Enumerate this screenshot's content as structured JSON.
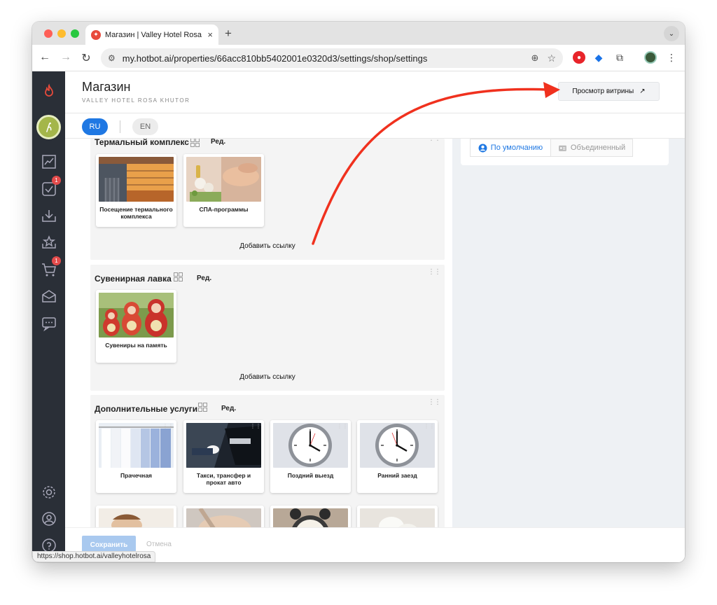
{
  "browser": {
    "tab_title": "Магазин | Valley Hotel Rosa Khutor",
    "tab_close": "×",
    "new_tab": "+",
    "url": "my.hotbot.ai/properties/66acc810bb5402001e0320d3/settings/shop/settings",
    "status_url": "https://shop.hotbot.ai/valleyhotelrosa"
  },
  "sidebar": {
    "badges": {
      "tasks": "1",
      "cart": "1"
    }
  },
  "header": {
    "title": "Магазин",
    "subtitle": "VALLEY HOTEL ROSA KHUTOR",
    "preview_label": "Просмотр витрины",
    "preview_icon": "↗"
  },
  "languages": {
    "ru": "RU",
    "en": "EN"
  },
  "view_toggle": {
    "default": "По умолчанию",
    "merged": "Объединенный"
  },
  "sections": [
    {
      "title": "Термальный комплекс",
      "edit": "Ред.",
      "add_link": "Добавить ссылку",
      "cards": [
        {
          "label": "Посещение термального комплекса"
        },
        {
          "label": "СПА-программы"
        }
      ]
    },
    {
      "title": "Сувенирная лавка",
      "edit": "Ред.",
      "add_link": "Добавить ссылку",
      "cards": [
        {
          "label": "Сувениры на память"
        }
      ]
    },
    {
      "title": "Дополнительные услуги",
      "edit": "Ред.",
      "cards": [
        {
          "label": "Прачечная"
        },
        {
          "label": "Такси, трансфер и прокат авто"
        },
        {
          "label": "Поздний выезд"
        },
        {
          "label": "Ранний заезд"
        }
      ]
    }
  ],
  "footer": {
    "save": "Сохранить",
    "cancel": "Отмена"
  },
  "colors": {
    "accent": "#1f78e3",
    "sidebar": "#2a2f37",
    "annotation_arrow": "#f0311e"
  }
}
